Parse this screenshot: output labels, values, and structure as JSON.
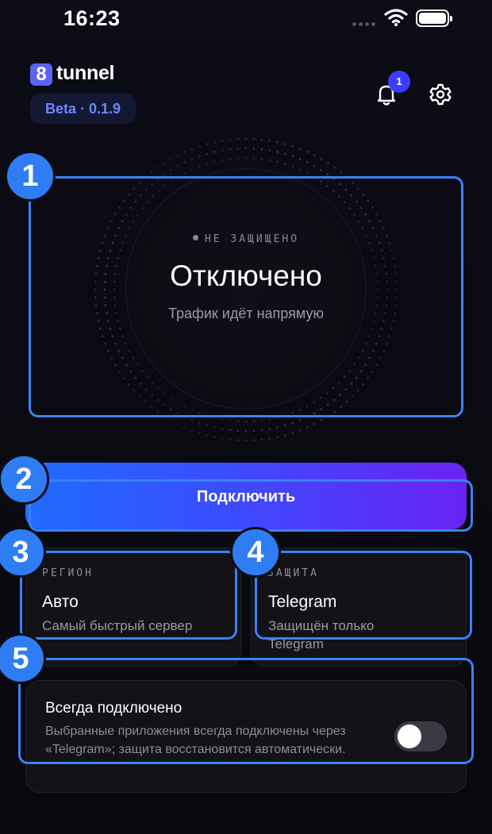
{
  "status_bar": {
    "time": "16:23",
    "icons": [
      "cellular-dots-icon",
      "wifi-icon",
      "battery-icon"
    ]
  },
  "header": {
    "logo_glyph": "8",
    "logo_text": "tunnel",
    "version": "Beta · 0.1.9",
    "notification_count": "1",
    "icons": [
      "bell-icon",
      "gear-icon"
    ]
  },
  "connection": {
    "state_label": "НЕ ЗАЩИЩЕНО",
    "state_title": "Отключено",
    "state_subtitle": "Трафик идёт напрямую"
  },
  "connect_button": {
    "label": "Подключить"
  },
  "region_card": {
    "kicker": "РЕГИОН",
    "value": "Авто",
    "description": "Самый быстрый сервер"
  },
  "protection_card": {
    "kicker": "ЗАЩИТА",
    "value": "Telegram",
    "description": "Защищён только Telegram"
  },
  "always_on": {
    "title": "Всегда подключено",
    "description": "Выбранные приложения всегда подключены через «Telegram»; защита восстановится автоматически.",
    "enabled": false
  },
  "annotations": [
    {
      "number": "1"
    },
    {
      "number": "2"
    },
    {
      "number": "3"
    },
    {
      "number": "4"
    },
    {
      "number": "5"
    }
  ],
  "colors": {
    "accent_blue": "#2f7df4",
    "badge_blue": "#3a3dff",
    "version_text": "#6a86ff",
    "button_gradient_start": "#1f6bff",
    "button_gradient_end": "#6a22f0",
    "background": "#0a0a12"
  }
}
